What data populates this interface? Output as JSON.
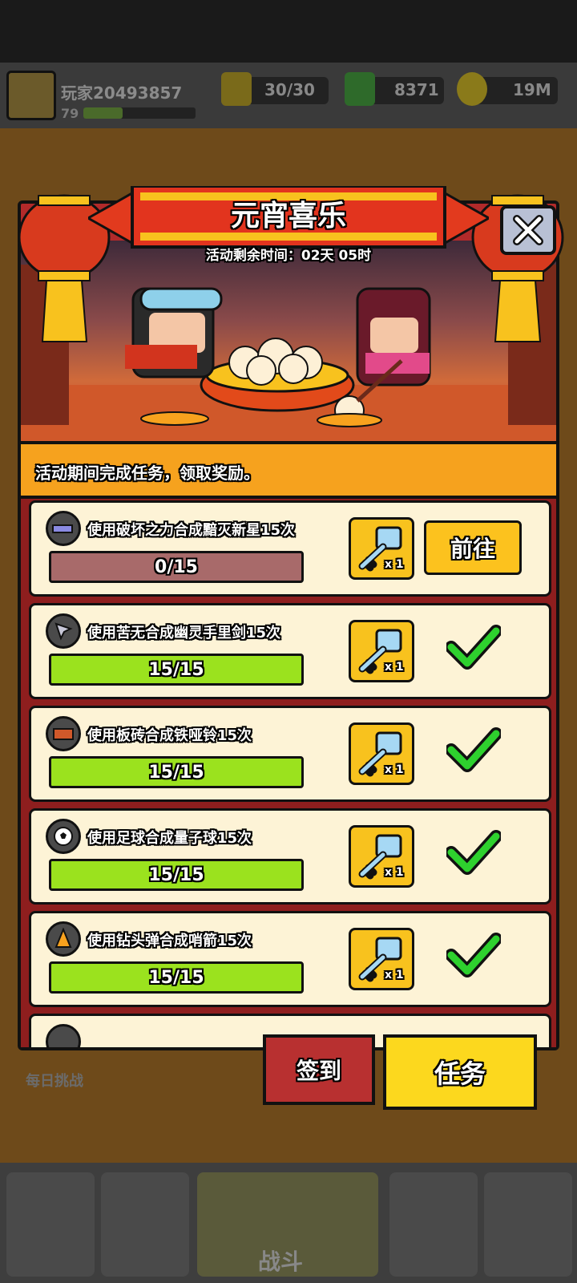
{
  "player": {
    "name": "玩家20493857",
    "level": "79",
    "xp_fraction": 0.35
  },
  "resources": {
    "energy": "30/30",
    "gems": "8371",
    "coins": "19M"
  },
  "background": {
    "daily_challenge_label": "每日挑战",
    "battle_label": "战斗"
  },
  "modal": {
    "title": "元宵喜乐",
    "timer": "活动剩余时间：02天 05时",
    "description": "活动期间完成任务，领取奖励。",
    "close_icon": "close-icon",
    "tasks": [
      {
        "title": "使用破坏之力合成黯灭新星15次",
        "progress": "0/15",
        "progress_fraction": 0.0,
        "reward_qty": "x 1",
        "status": "go",
        "go_label": "前往",
        "icon": "gun-icon"
      },
      {
        "title": "使用苦无合成幽灵手里剑15次",
        "progress": "15/15",
        "progress_fraction": 1.0,
        "reward_qty": "x 1",
        "status": "done",
        "icon": "kunai-icon"
      },
      {
        "title": "使用板砖合成铁哑铃15次",
        "progress": "15/15",
        "progress_fraction": 1.0,
        "reward_qty": "x 1",
        "status": "done",
        "icon": "brick-icon"
      },
      {
        "title": "使用足球合成量子球15次",
        "progress": "15/15",
        "progress_fraction": 1.0,
        "reward_qty": "x 1",
        "status": "done",
        "icon": "soccer-ball-icon"
      },
      {
        "title": "使用钻头弹合成哨箭15次",
        "progress": "15/15",
        "progress_fraction": 1.0,
        "reward_qty": "x 1",
        "status": "done",
        "icon": "drill-bullet-icon"
      }
    ]
  },
  "tabs": {
    "signin": "签到",
    "tasks": "任务"
  },
  "colors": {
    "progress_empty": "#a86a6a",
    "progress_full": "#9be21e",
    "check_green": "#2ed12e",
    "accent_yellow": "#fcc21e"
  }
}
